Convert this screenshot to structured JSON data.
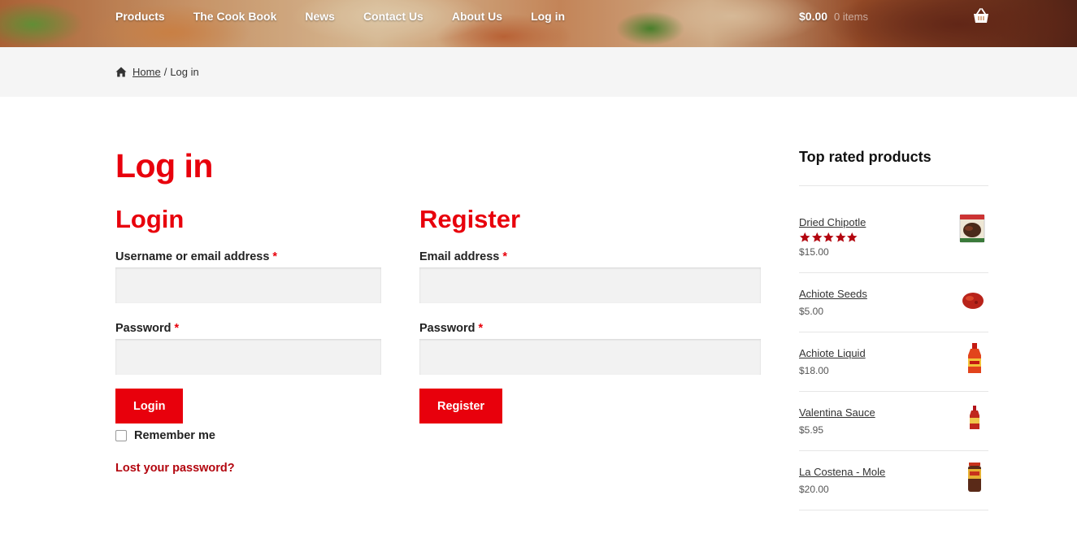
{
  "nav": {
    "items": [
      "Products",
      "The Cook Book",
      "News",
      "Contact Us",
      "About Us",
      "Log in"
    ]
  },
  "cart": {
    "amount": "$0.00",
    "count": "0 items",
    "icon": "basket-icon"
  },
  "breadcrumb": {
    "home": "Home",
    "separator": "/",
    "current": "Log in",
    "icon": "home-icon"
  },
  "page": {
    "title": "Log in"
  },
  "login": {
    "heading": "Login",
    "username_label": "Username or email address",
    "password_label": "Password",
    "required_mark": "*",
    "username_value": "",
    "password_value": "",
    "submit_label": "Login",
    "remember_label": "Remember me",
    "remember_checked": false,
    "lost_password": "Lost your password?"
  },
  "register": {
    "heading": "Register",
    "email_label": "Email address",
    "password_label": "Password",
    "required_mark": "*",
    "email_value": "",
    "password_value": "",
    "submit_label": "Register"
  },
  "sidebar": {
    "title": "Top rated products",
    "products": [
      {
        "name": "Dried Chipotle",
        "price": "$15.00",
        "rating": 5
      },
      {
        "name": "Achiote Seeds",
        "price": "$5.00"
      },
      {
        "name": "Achiote Liquid",
        "price": "$18.00"
      },
      {
        "name": "Valentina Sauce",
        "price": "$5.95"
      },
      {
        "name": "La Costena - Mole",
        "price": "$20.00"
      }
    ]
  },
  "colors": {
    "accent": "#e8000c",
    "link_dark_red": "#b3060f",
    "star": "#b3060f"
  }
}
